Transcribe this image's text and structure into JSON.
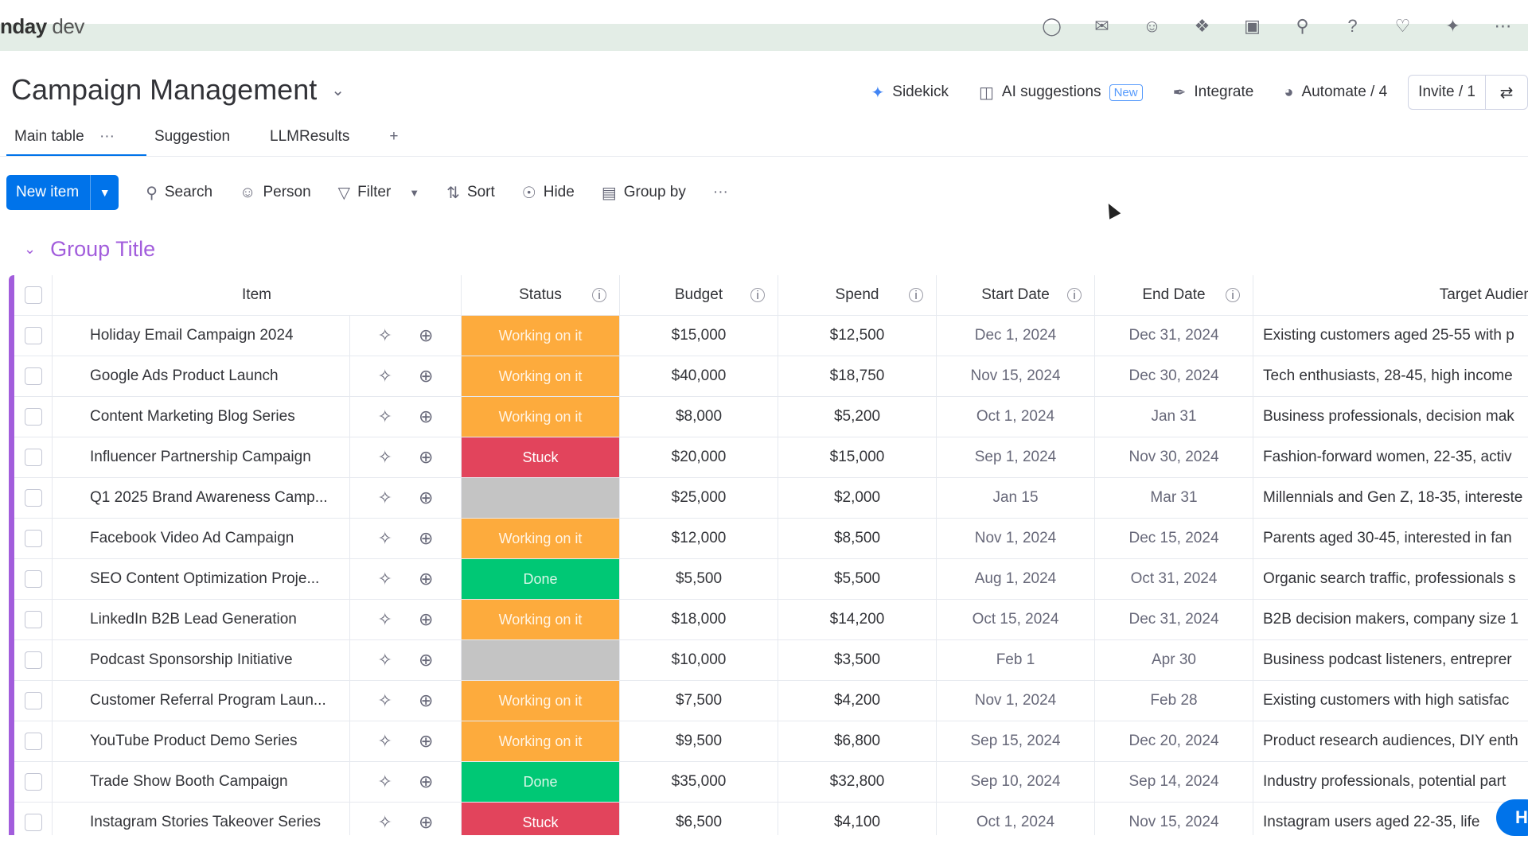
{
  "app": {
    "brand_name": "nday",
    "brand_suffix": " dev",
    "top_icons": [
      "bell-icon",
      "inbox-icon",
      "invite-member-icon",
      "apps-icon",
      "robot-icon",
      "search-icon",
      "help-icon",
      "gift-icon",
      "ai-icon",
      "grid-menu-icon"
    ]
  },
  "header": {
    "title": "Campaign Management",
    "actions": {
      "sidekick": "Sidekick",
      "ai_suggestions": "AI suggestions",
      "new_badge": "New",
      "integrate": "Integrate",
      "automate": "Automate / 4",
      "invite": "Invite / 1"
    }
  },
  "tabs": [
    {
      "label": "Main table",
      "active": true
    },
    {
      "label": "Suggestion",
      "active": false
    },
    {
      "label": "LLMResults",
      "active": false
    }
  ],
  "tab_more": "···",
  "tab_add": "+",
  "toolbar": {
    "new_item": "New item",
    "search": "Search",
    "person": "Person",
    "filter": "Filter",
    "sort": "Sort",
    "hide": "Hide",
    "group_by": "Group by",
    "more": "···"
  },
  "group": {
    "title": "Group Title",
    "accent_color": "#a25ddc"
  },
  "columns": {
    "item": "Item",
    "status": "Status",
    "budget": "Budget",
    "spend": "Spend",
    "start_date": "Start Date",
    "end_date": "End Date",
    "target_audience": "Target Audien"
  },
  "status_colors": {
    "working": "#fdab3d",
    "stuck": "#e2445c",
    "done": "#00c875",
    "empty": "#c4c4c4"
  },
  "rows": [
    {
      "item": "Holiday Email Campaign 2024",
      "status": "Working on it",
      "status_kind": "working",
      "budget": "$15,000",
      "spend": "$12,500",
      "start": "Dec 1, 2024",
      "end": "Dec 31, 2024",
      "audience": "Existing customers aged 25-55 with p"
    },
    {
      "item": "Google Ads Product Launch",
      "status": "Working on it",
      "status_kind": "working",
      "budget": "$40,000",
      "spend": "$18,750",
      "start": "Nov 15, 2024",
      "end": "Dec 30, 2024",
      "audience": "Tech enthusiasts, 28-45, high income"
    },
    {
      "item": "Content Marketing Blog Series",
      "status": "Working on it",
      "status_kind": "working",
      "budget": "$8,000",
      "spend": "$5,200",
      "start": "Oct 1, 2024",
      "end": "Jan 31",
      "audience": "Business professionals, decision mak"
    },
    {
      "item": "Influencer Partnership Campaign",
      "status": "Stuck",
      "status_kind": "stuck",
      "budget": "$20,000",
      "spend": "$15,000",
      "start": "Sep 1, 2024",
      "end": "Nov 30, 2024",
      "audience": "Fashion-forward women, 22-35, activ"
    },
    {
      "item": "Q1 2025 Brand Awareness Camp...",
      "status": "",
      "status_kind": "empty",
      "budget": "$25,000",
      "spend": "$2,000",
      "start": "Jan 15",
      "end": "Mar 31",
      "audience": "Millennials and Gen Z, 18-35, intereste"
    },
    {
      "item": "Facebook Video Ad Campaign",
      "status": "Working on it",
      "status_kind": "working",
      "budget": "$12,000",
      "spend": "$8,500",
      "start": "Nov 1, 2024",
      "end": "Dec 15, 2024",
      "audience": "Parents aged 30-45, interested in fan"
    },
    {
      "item": "SEO Content Optimization Proje...",
      "status": "Done",
      "status_kind": "done",
      "budget": "$5,500",
      "spend": "$5,500",
      "start": "Aug 1, 2024",
      "end": "Oct 31, 2024",
      "audience": "Organic search traffic, professionals s"
    },
    {
      "item": "LinkedIn B2B Lead Generation",
      "status": "Working on it",
      "status_kind": "working",
      "budget": "$18,000",
      "spend": "$14,200",
      "start": "Oct 15, 2024",
      "end": "Dec 31, 2024",
      "audience": "B2B decision makers, company size 1"
    },
    {
      "item": "Podcast Sponsorship Initiative",
      "status": "",
      "status_kind": "empty",
      "budget": "$10,000",
      "spend": "$3,500",
      "start": "Feb 1",
      "end": "Apr 30",
      "audience": "Business podcast listeners, entreprer"
    },
    {
      "item": "Customer Referral Program Laun...",
      "status": "Working on it",
      "status_kind": "working",
      "budget": "$7,500",
      "spend": "$4,200",
      "start": "Nov 1, 2024",
      "end": "Feb 28",
      "audience": "Existing customers with high satisfac"
    },
    {
      "item": "YouTube Product Demo Series",
      "status": "Working on it",
      "status_kind": "working",
      "budget": "$9,500",
      "spend": "$6,800",
      "start": "Sep 15, 2024",
      "end": "Dec 20, 2024",
      "audience": "Product research audiences, DIY enth"
    },
    {
      "item": "Trade Show Booth Campaign",
      "status": "Done",
      "status_kind": "done",
      "budget": "$35,000",
      "spend": "$32,800",
      "start": "Sep 10, 2024",
      "end": "Sep 14, 2024",
      "audience": "Industry professionals, potential part"
    },
    {
      "item": "Instagram Stories Takeover Series",
      "status": "Stuck",
      "status_kind": "stuck",
      "budget": "$6,500",
      "spend": "$4,100",
      "start": "Oct 1, 2024",
      "end": "Nov 15, 2024",
      "audience": "Instagram users aged 22-35, life"
    }
  ],
  "help_button": "H"
}
